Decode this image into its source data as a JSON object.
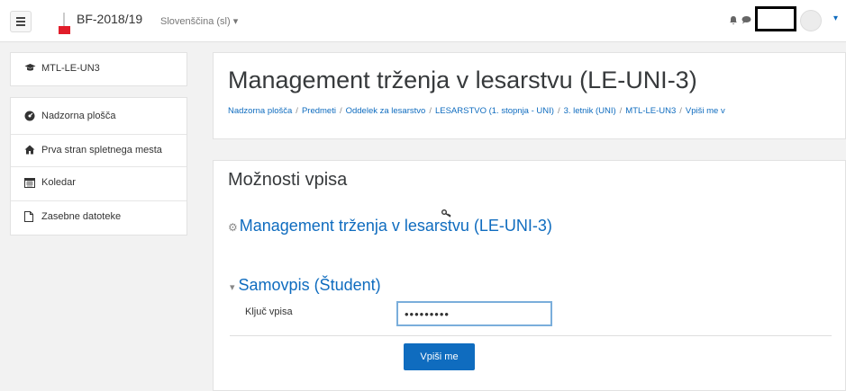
{
  "navbar": {
    "site_name": "BF-2018/19",
    "language": "Slovenščina (sl) ▾",
    "icons": [
      "menu-icon",
      "bell-icon",
      "chat-icon",
      "user-avatar",
      "caret-down-icon"
    ],
    "caret": "▾"
  },
  "sidebar": {
    "course_item": {
      "label": "MTL-LE-UN3",
      "icon": "graduation-cap-icon"
    },
    "items": [
      {
        "label": "Nadzorna plošča",
        "icon": "dashboard-icon"
      },
      {
        "label": "Prva stran spletnega mesta",
        "icon": "home-icon"
      },
      {
        "label": "Koledar",
        "icon": "calendar-icon"
      },
      {
        "label": "Zasebne datoteke",
        "icon": "file-icon"
      }
    ]
  },
  "header": {
    "title": "Management trženja v lesarstvu (LE-UNI-3)",
    "breadcrumb": [
      "Nadzorna plošča",
      "Predmeti",
      "Oddelek za lesarstvo",
      "LESARSTVO (1. stopnja - UNI)",
      "3. letnik (UNI)",
      "MTL-LE-UN3",
      "Vpiši me v"
    ]
  },
  "main": {
    "heading": "Možnosti vpisa",
    "course_link": "Management trženja v lesarstvu (LE-UNI-3)",
    "section_title": "Samovpis (Študent)",
    "key_label": "Ključ vpisa",
    "key_value": "•••••••••",
    "submit_label": "Vpiši me"
  },
  "colors": {
    "accent": "#0f6cbf",
    "brand": "#e11d2a"
  }
}
